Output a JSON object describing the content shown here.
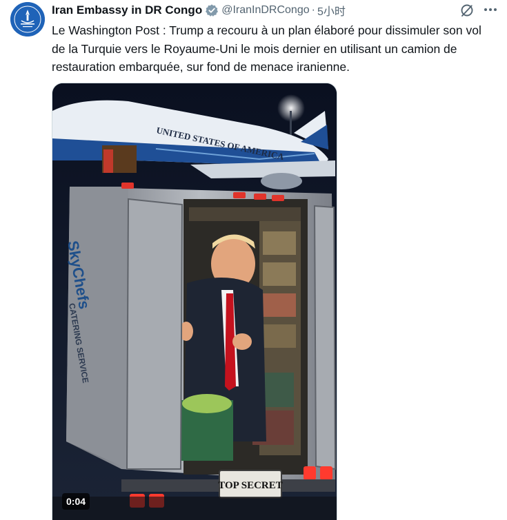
{
  "tweet": {
    "author": {
      "display_name": "Iran Embassy in DR Congo",
      "handle": "@IranInDRCongo",
      "verified_color": "#829aab"
    },
    "separator": "·",
    "time": "5小时",
    "text": "Le Washington Post : Trump a recouru à un plan élaboré pour dissimuler son vol de la Turquie vers le Royaume-Uni le mois dernier en utilisant un camion de restauration embarquée, sur fond de menace iranienne.",
    "media": {
      "duration": "0:04",
      "plane_lettering": "UNITED STATES OF AMERICA",
      "truck_lettering": "SkyChefs",
      "truck_side_text": "CATERING SERVICE",
      "plate_text": "TOP SECRET"
    }
  },
  "icons": {
    "grok": "grok-icon",
    "more": "more-icon",
    "verified": "verified-badge-icon"
  }
}
